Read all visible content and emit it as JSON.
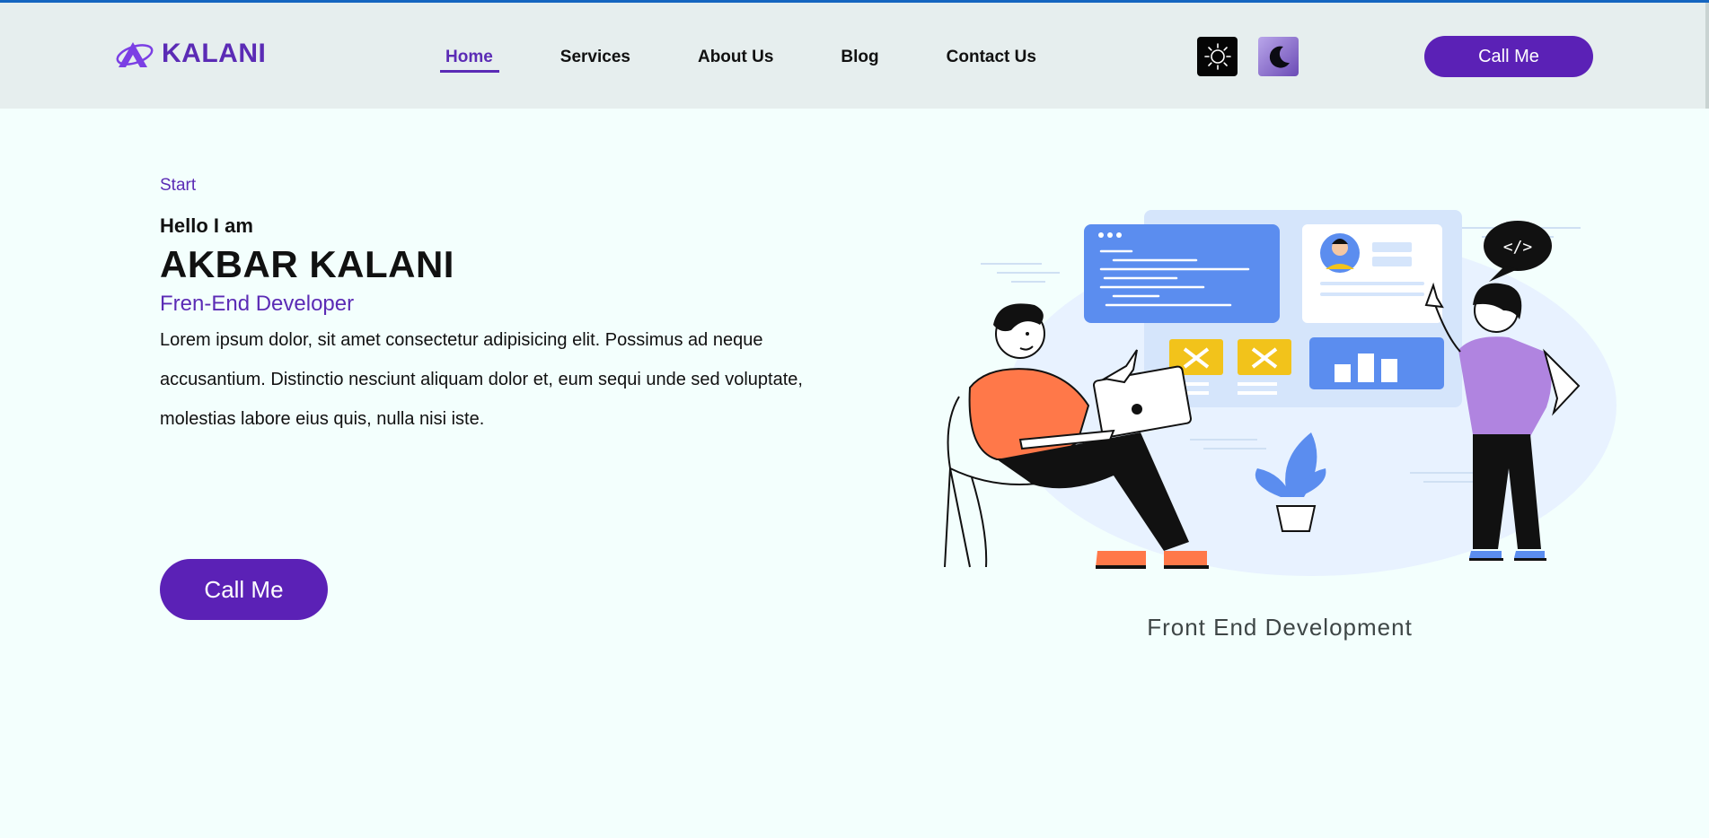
{
  "header": {
    "logo_text": "KALANI",
    "nav": [
      {
        "label": "Home",
        "active": true
      },
      {
        "label": "Services",
        "active": false
      },
      {
        "label": "About Us",
        "active": false
      },
      {
        "label": "Blog",
        "active": false
      },
      {
        "label": "Contact Us",
        "active": false
      }
    ],
    "theme_light_icon": "sun-icon",
    "theme_dark_icon": "moon-icon",
    "cta_label": "Call Me"
  },
  "hero": {
    "eyebrow": "Start",
    "greeting": "Hello I am",
    "name": "AKBAR KALANI",
    "role": "Fren-End Developer",
    "description": "Lorem ipsum dolor, sit amet consectetur adipisicing elit. Possimus ad neque accusantium. Distinctio nesciunt aliquam dolor et, eum sequi unde sed voluptate, molestias labore eius quis, nulla nisi iste.",
    "cta_label": "Call Me"
  },
  "illustration": {
    "caption": "Front End Development",
    "code_bubble": "</>"
  },
  "colors": {
    "brand": "#5b21b6",
    "header_bg": "#e6eeee",
    "page_bg": "#f3fffd",
    "accent_blue": "#5b8def",
    "accent_yellow": "#f2c31b",
    "accent_orange": "#ff7849",
    "accent_purple": "#b084e0"
  }
}
